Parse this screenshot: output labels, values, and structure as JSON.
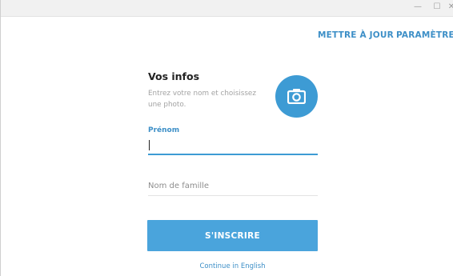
{
  "window": {
    "minimize_glyph": "—",
    "maximize_glyph": "☐",
    "close_glyph": "✕"
  },
  "nav": {
    "update_label": "METTRE À JOUR",
    "settings_label": "PARAMÈTRES"
  },
  "form": {
    "heading": "Vos infos",
    "description": "Entrez votre nom et choisissez une photo.",
    "photo_icon": "camera-icon",
    "first_name_label": "Prénom",
    "first_name_value": "",
    "last_name_placeholder": "Nom de famille",
    "last_name_value": "",
    "submit_label": "S'INSCRIRE",
    "language_link": "Continue in English"
  },
  "colors": {
    "accent": "#3d9bd4",
    "button": "#4aa4dc",
    "link": "#3d8fc7"
  }
}
